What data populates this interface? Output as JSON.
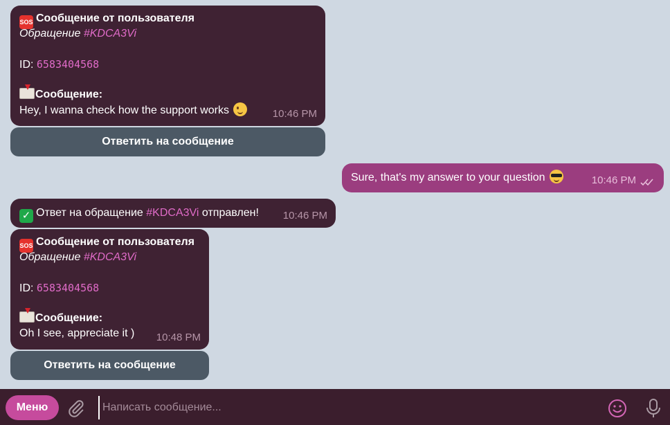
{
  "messages": [
    {
      "title": "Сообщение от пользователя",
      "ticket_prefix": "Обращение ",
      "ticket_tag": "#KDCA3Vi",
      "id_label": "ID: ",
      "id_value": "6583404568",
      "message_label": "Сообщение:",
      "message_text": "Hey, I wanna check how the support works",
      "time": "10:46 PM",
      "button": "Ответить на сообщение"
    },
    {
      "outgoing_text": "Sure, that's my answer to your question",
      "time": "10:46 PM"
    },
    {
      "confirm_prefix": "Ответ на обращение ",
      "confirm_tag": "#KDCA3Vi",
      "confirm_suffix": " отправлен!",
      "time": "10:46 PM"
    },
    {
      "title": "Сообщение от пользователя",
      "ticket_prefix": "Обращение ",
      "ticket_tag": "#KDCA3Vi",
      "id_label": "ID: ",
      "id_value": "6583404568",
      "message_label": "Сообщение:",
      "message_text": "Oh I see, appreciate it )",
      "time": "10:48 PM",
      "button": "Ответить на сообщение"
    }
  ],
  "composer": {
    "menu_label": "Меню",
    "placeholder": "Написать сообщение..."
  },
  "icons": {
    "sos": "SOS",
    "check": "✓",
    "mail": "incoming-envelope-icon",
    "wink": "winking-face-icon",
    "cool": "sunglasses-face-icon",
    "attach": "paperclip-icon",
    "emoji": "smiley-icon",
    "mic": "microphone-icon",
    "read": "double-check-icon"
  },
  "colors": {
    "incoming_bubble": "#3f2233",
    "outgoing_bubble": "#9b3d7f",
    "accent_link": "#e06bc8",
    "menu_button": "#c64b9d",
    "inline_button": "#4c5965",
    "background": "#cfd8e2"
  }
}
